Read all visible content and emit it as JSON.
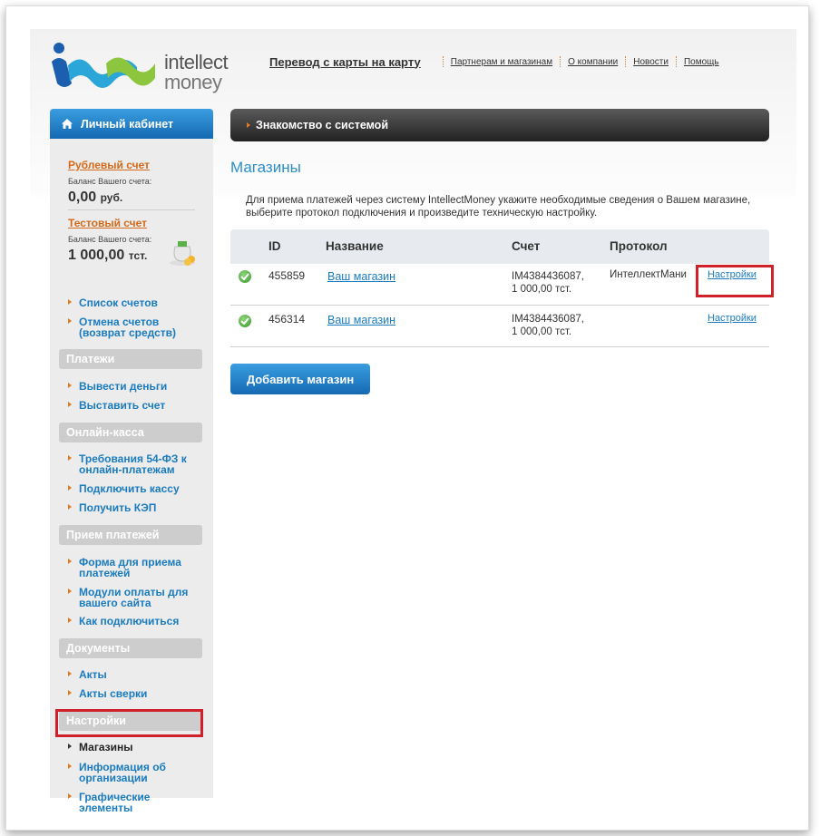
{
  "logo": {
    "line1": "intellect",
    "line2": "money"
  },
  "topnav": {
    "main": "Перевод с карты на карту",
    "links": [
      "Партнерам и магазинам",
      "О компании",
      "Новости",
      "Помощь"
    ]
  },
  "sidebar": {
    "header": "Личный кабинет",
    "accounts": [
      {
        "link": "Рублевый счет",
        "balance_label": "Баланс Вашего счета:",
        "value": "0,00",
        "currency": "руб."
      },
      {
        "link": "Тестовый счет",
        "balance_label": "Баланс Вашего счета:",
        "value": "1 000,00",
        "currency": "тст."
      }
    ],
    "account_links": [
      "Список счетов",
      "Отмена счетов (возврат средств)"
    ],
    "sections": [
      {
        "title": "Платежи",
        "items": [
          "Вывести деньги",
          "Выставить счет"
        ]
      },
      {
        "title": "Онлайн-касса",
        "items": [
          "Требования 54-ФЗ к онлайн-платежам",
          "Подключить кассу",
          "Получить КЭП"
        ]
      },
      {
        "title": "Прием платежей",
        "items": [
          "Форма для приема платежей",
          "Модули оплаты для вашего сайта",
          "Как подключиться"
        ]
      },
      {
        "title": "Документы",
        "items": [
          "Акты",
          "Акты сверки"
        ]
      },
      {
        "title": "Настройки",
        "items": [
          "Магазины",
          "Информация об организации",
          "Графические элементы"
        ]
      }
    ]
  },
  "main": {
    "bar_title": "Знакомство с системой",
    "page_title": "Магазины",
    "description": "Для приема платежей через систему IntellectMoney укажите необходимые сведения о Вашем магазине, выберите протокол подключения и произведите техническую настройку.",
    "table": {
      "headers": [
        "ID",
        "Название",
        "Счет",
        "Протокол"
      ],
      "rows": [
        {
          "id": "455859",
          "name": "Ваш магазин",
          "account_line1": "IM4384436087,",
          "account_line2": "1 000,00 тст.",
          "protocol": "ИнтеллектМани",
          "settings": "Настройки"
        },
        {
          "id": "456314",
          "name": "Ваш магазин",
          "account_line1": "IM4384436087,",
          "account_line2": "1 000,00 тст.",
          "protocol": "",
          "settings": "Настройки"
        }
      ]
    },
    "add_button": "Добавить магазин"
  },
  "colors": {
    "accent_blue": "#1a7bbf",
    "accent_orange": "#d46a1a",
    "highlight_red": "#d0202a"
  }
}
